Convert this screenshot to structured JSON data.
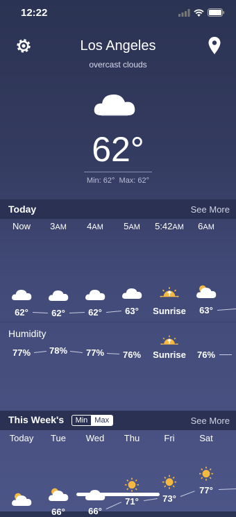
{
  "status": {
    "time": "12:22"
  },
  "header": {
    "city": "Los Angeles",
    "condition": "overcast clouds"
  },
  "current": {
    "temp": "62°",
    "min": "Min: 62°",
    "max": "Max: 62°"
  },
  "today": {
    "title": "Today",
    "see_more": "See More",
    "hours": [
      {
        "main": "Now",
        "sub": "",
        "icon": "cloudy-night-icon",
        "temp": "62°"
      },
      {
        "main": "3",
        "sub": "AM",
        "icon": "cloudy-night-icon",
        "temp": "62°"
      },
      {
        "main": "4",
        "sub": "AM",
        "icon": "cloud-icon",
        "temp": "62°"
      },
      {
        "main": "5",
        "sub": "AM",
        "icon": "cloud-icon",
        "temp": "63°"
      },
      {
        "main": "5:42",
        "sub": "AM",
        "icon": "sunrise-icon",
        "temp": "Sunrise"
      },
      {
        "main": "6",
        "sub": "AM",
        "icon": "partly-cloudy-day-icon",
        "temp": "63°"
      }
    ],
    "humidity_label": "Humidity",
    "humidity": [
      "77%",
      "78%",
      "77%",
      "76%",
      "Sunrise",
      "76%"
    ]
  },
  "week": {
    "title": "This Week's",
    "toggle_min": "Min",
    "toggle_max": "Max",
    "see_more": "See More",
    "days": [
      {
        "name": "Today",
        "icon": "cloudy-day-icon",
        "temp": ""
      },
      {
        "name": "Tue",
        "icon": "cloudy-day-icon",
        "temp": "66°"
      },
      {
        "name": "Wed",
        "icon": "cloud-icon",
        "temp": "66°"
      },
      {
        "name": "Thu",
        "icon": "sun-icon",
        "temp": "71°"
      },
      {
        "name": "Fri",
        "icon": "sun-icon",
        "temp": "73°"
      },
      {
        "name": "Sat",
        "icon": "sun-icon",
        "temp": "77°"
      }
    ]
  }
}
